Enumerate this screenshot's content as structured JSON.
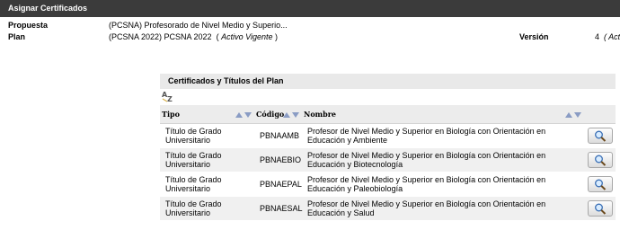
{
  "window": {
    "title": "Asignar Certificados"
  },
  "info": {
    "propuesta_label": "Propuesta",
    "propuesta_value": "(PCSNA) Profesorado de Nivel Medio y Superio...",
    "plan_label": "Plan",
    "plan_value": "(PCSNA 2022) PCSNA 2022",
    "plan_status_open": "(",
    "plan_status": "Activo Vigente",
    "plan_status_close": ")",
    "version_label": "Versión",
    "version_value": "4",
    "version_status": "( Acti"
  },
  "section": {
    "title": "Certificados y Títulos del Plan"
  },
  "table": {
    "columns": [
      {
        "label": "Tipo"
      },
      {
        "label": "Código"
      },
      {
        "label": "Nombre"
      }
    ],
    "rows": [
      {
        "tipo": "Título de Grado Universitario",
        "codigo": "PBNAAMB",
        "nombre": "Profesor de Nivel Medio y Superior en Biología con Orientación en Educación y Ambiente"
      },
      {
        "tipo": "Título de Grado Universitario",
        "codigo": "PBNAEBIO",
        "nombre": "Profesor de Nivel Medio y Superior en Biología con Orientación en Educación y Biotecnología"
      },
      {
        "tipo": "Título de Grado Universitario",
        "codigo": "PBNAEPAL",
        "nombre": "Profesor de Nivel Medio y Superior en Biología con Orientación en Educación y Paleobiología"
      },
      {
        "tipo": "Título de Grado Universitario",
        "codigo": "PBNAESAL",
        "nombre": "Profesor de Nivel Medio y Superior en Biología con Orientación en Educación y Salud"
      }
    ]
  },
  "icons": {
    "sort": "sort-asc-desc-icon",
    "az": "az-sort-icon",
    "search": "magnifier-icon"
  },
  "colors": {
    "title_bar": "#3b3b3b",
    "header_bg": "#e9e9e9",
    "row_alt": "#f0f0f0"
  }
}
